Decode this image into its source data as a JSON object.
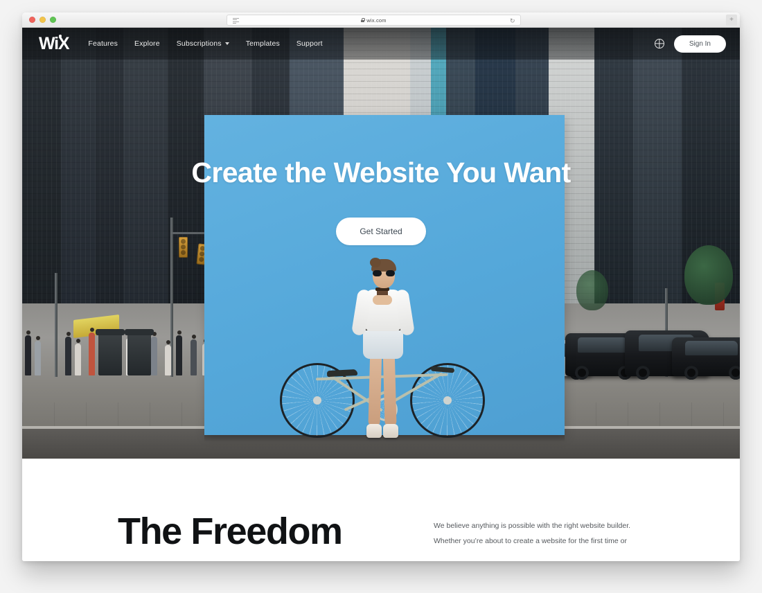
{
  "browser": {
    "traffic_lights": [
      "close",
      "minimize",
      "maximize"
    ],
    "url": "wix.com",
    "reader_icon": "reader-view-icon",
    "lock_icon": "lock-icon",
    "reload_label": "↻",
    "new_tab_label": "+"
  },
  "site": {
    "logo": "WiX",
    "nav": [
      {
        "label": "Features",
        "has_dropdown": false
      },
      {
        "label": "Explore",
        "has_dropdown": false
      },
      {
        "label": "Subscriptions",
        "has_dropdown": true
      },
      {
        "label": "Templates",
        "has_dropdown": false
      },
      {
        "label": "Support",
        "has_dropdown": false
      }
    ],
    "language_icon": "globe-icon",
    "signin_label": "Sign In"
  },
  "hero": {
    "headline": "Create the Website You Want",
    "cta_label": "Get Started",
    "panel_color": "#58ACDD",
    "image_alt": "Woman with bicycle holding coffee in front of a blue wall on a city street"
  },
  "section": {
    "heading": "The Freedom",
    "paragraph_line_1": "We believe anything is possible with the right website builder.",
    "paragraph_line_2": "Whether you’re about to create a website for the first time or"
  },
  "colors": {
    "accent_blue": "#58ACDD",
    "nav_text": "#ECECEC",
    "body_text": "#55595D",
    "heading_text": "#101214",
    "page_bg": "#F3F3F3"
  }
}
